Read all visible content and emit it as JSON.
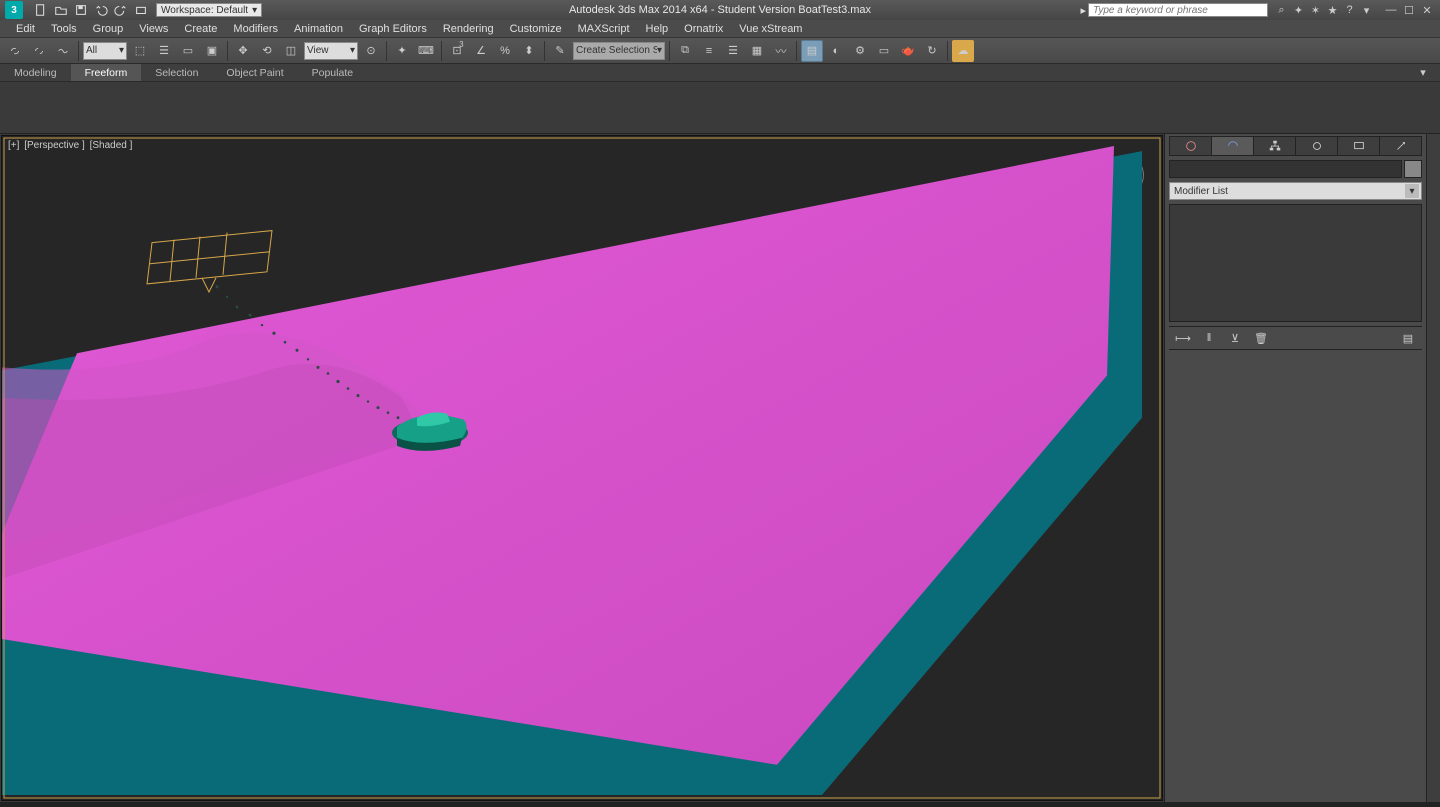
{
  "app": {
    "title": "Autodesk 3ds Max 2014 x64  - Student Version   BoatTest3.max",
    "search_placeholder": "Type a keyword or phrase"
  },
  "workspace": {
    "label": "Workspace: Default"
  },
  "menu": [
    "Edit",
    "Tools",
    "Group",
    "Views",
    "Create",
    "Modifiers",
    "Animation",
    "Graph Editors",
    "Rendering",
    "Customize",
    "MAXScript",
    "Help",
    "Ornatrix",
    "Vue xStream"
  ],
  "toolbar": {
    "filter_all": "All",
    "ref_coord": "View",
    "spinner_val": "3",
    "selset": "Create Selection Se"
  },
  "ribbon": {
    "tabs": [
      "Modeling",
      "Freeform",
      "Selection",
      "Object Paint",
      "Populate"
    ],
    "active": "Freeform"
  },
  "viewport": {
    "label_plus": "[+]",
    "label_view": "[Perspective ]",
    "label_shade": "[Shaded ]"
  },
  "cmd": {
    "modifier_list": "Modifier List"
  }
}
